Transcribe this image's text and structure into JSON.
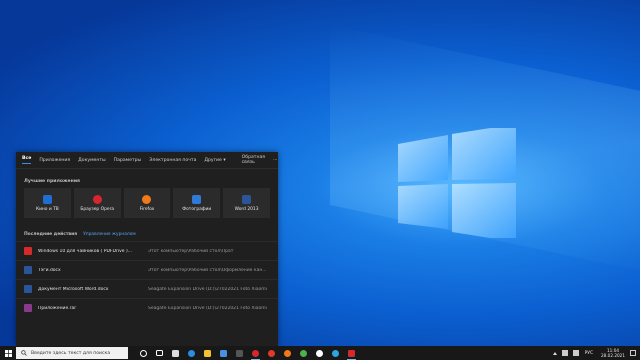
{
  "panel": {
    "tabs": [
      "Все",
      "Приложения",
      "Документы",
      "Параметры",
      "Электронная почта",
      "Другие ▾"
    ],
    "feedback": "Обратная связь",
    "more": "···",
    "top_apps_title": "Лучшие приложения",
    "apps": [
      {
        "label": "Кино и ТВ",
        "icon": "movies-icon",
        "color": "#1e6fd1"
      },
      {
        "label": "Браузер Opera",
        "icon": "opera-icon",
        "color": "#d7262e"
      },
      {
        "label": "Firefox",
        "icon": "firefox-icon",
        "color": "#f07a1a"
      },
      {
        "label": "Фотографии",
        "icon": "photos-icon",
        "color": "#2f7ad6"
      },
      {
        "label": "Word 2013",
        "icon": "word-icon",
        "color": "#2a5699"
      }
    ],
    "recent_title": "Последние действия",
    "manage_history": "Управление журналом",
    "recent": [
      {
        "name": "Windows 10 для чайников ( PDFDrive )...",
        "path": "Этот компьютер\\Рабочий стол\\Прат",
        "icon": "pdf-icon",
        "color": "#d42a2a"
      },
      {
        "name": "Тэги.docx",
        "path": "Этот компьютер\\Рабочий стол\\Оформление кан...",
        "icon": "word-doc-icon",
        "color": "#2a5699"
      },
      {
        "name": "Документ Microsoft Word.docx",
        "path": "Seagate Expansion Drive (D:)\\27022021 Foto Xiaomi",
        "icon": "word-doc-icon",
        "color": "#2a5699"
      },
      {
        "name": "Приложение.rar",
        "path": "Seagate Expansion Drive (D:)\\27022021 Foto Xiaomi",
        "icon": "rar-icon",
        "color": "#8a3a8a"
      }
    ]
  },
  "taskbar": {
    "search_placeholder": "Введите здесь текст для поиска",
    "icons": [
      {
        "name": "cortana-icon",
        "color": "#ffffff"
      },
      {
        "name": "task-view-icon",
        "color": "#ffffff"
      },
      {
        "name": "store-icon",
        "color": "#ffffff"
      },
      {
        "name": "edge-icon",
        "color": "#2b8de0"
      },
      {
        "name": "file-explorer-icon",
        "color": "#f2c230"
      },
      {
        "name": "mail-icon",
        "color": "#4a90e2"
      },
      {
        "name": "app-icon",
        "color": "#3a3a3a"
      },
      {
        "name": "opera-icon",
        "color": "#d7262e"
      },
      {
        "name": "yandex-icon",
        "color": "#e03a2a"
      },
      {
        "name": "firefox-icon",
        "color": "#f07a1a"
      },
      {
        "name": "chrome-icon",
        "color": "#4caf50"
      },
      {
        "name": "yandex-browser-icon",
        "color": "#ffffff"
      },
      {
        "name": "telegram-icon",
        "color": "#2ca5e0"
      },
      {
        "name": "pdf-icon",
        "color": "#d42a2a"
      }
    ],
    "lang": "РУС",
    "time": "11:04",
    "date": "28.02.2021"
  }
}
